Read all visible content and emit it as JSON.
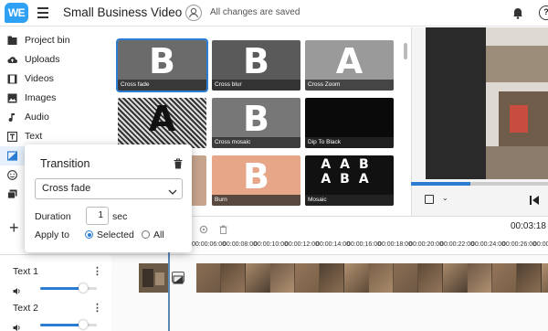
{
  "header": {
    "logo_text": "WE",
    "title": "Small Business Video",
    "save_status": "All changes are saved",
    "help_glyph": "?"
  },
  "sidebar": {
    "items": [
      {
        "label": "Project bin",
        "icon": "folder-icon"
      },
      {
        "label": "Uploads",
        "icon": "cloud-upload-icon"
      },
      {
        "label": "Videos",
        "icon": "film-icon"
      },
      {
        "label": "Images",
        "icon": "image-icon"
      },
      {
        "label": "Audio",
        "icon": "music-note-icon"
      },
      {
        "label": "Text",
        "icon": "text-icon"
      },
      {
        "label": "T",
        "icon": "transitions-icon"
      }
    ]
  },
  "thumbnails": [
    {
      "label": "Cross fade",
      "glyph": "B",
      "bg": "#6b6b6b"
    },
    {
      "label": "Cross blur",
      "glyph": "B",
      "bg": "#5a5a5a"
    },
    {
      "label": "Cross Zoom",
      "glyph": "A",
      "bg": "#9a9a9a"
    },
    {
      "label": "",
      "glyph": "A",
      "bg": "#8a8a8a"
    },
    {
      "label": "Cross mosaic",
      "glyph": "B",
      "bg": "#777777"
    },
    {
      "label": "Dip To Black",
      "glyph": "",
      "bg": "#0a0a0a"
    },
    {
      "label": "",
      "glyph": "",
      "bg": "#c7a58d"
    },
    {
      "label": "Burn",
      "glyph": "B",
      "bg": "#e6a687"
    },
    {
      "label": "Mosaic",
      "glyph": "AB",
      "bg": "#111111"
    }
  ],
  "panel": {
    "title": "Transition",
    "selected_transition": "Cross fade",
    "duration_label": "Duration",
    "duration_value": "1",
    "duration_unit": "sec",
    "apply_label": "Apply to",
    "apply_options": [
      "Selected",
      "All"
    ],
    "apply_selected": "Selected"
  },
  "timeline": {
    "timecode": "00:03:18",
    "ticks": [
      "00:00:06:00",
      "00:00:08:00",
      "00:00:10:00",
      "00:00:12:00",
      "00:00:14:00",
      "00:00:16:00",
      "00:00:18:00",
      "00:00:20:00",
      "00:00:22:00",
      "00:00:24:00",
      "00:00:26:00",
      "00:00:28:00"
    ],
    "tracks": [
      {
        "label": "Text  1",
        "volume": 0.75
      },
      {
        "label": "Text 2",
        "volume": 0.75
      }
    ],
    "video_progress": 0.43
  },
  "colors": {
    "accent": "#2b7cd3",
    "logo": "#2fa1f5"
  }
}
